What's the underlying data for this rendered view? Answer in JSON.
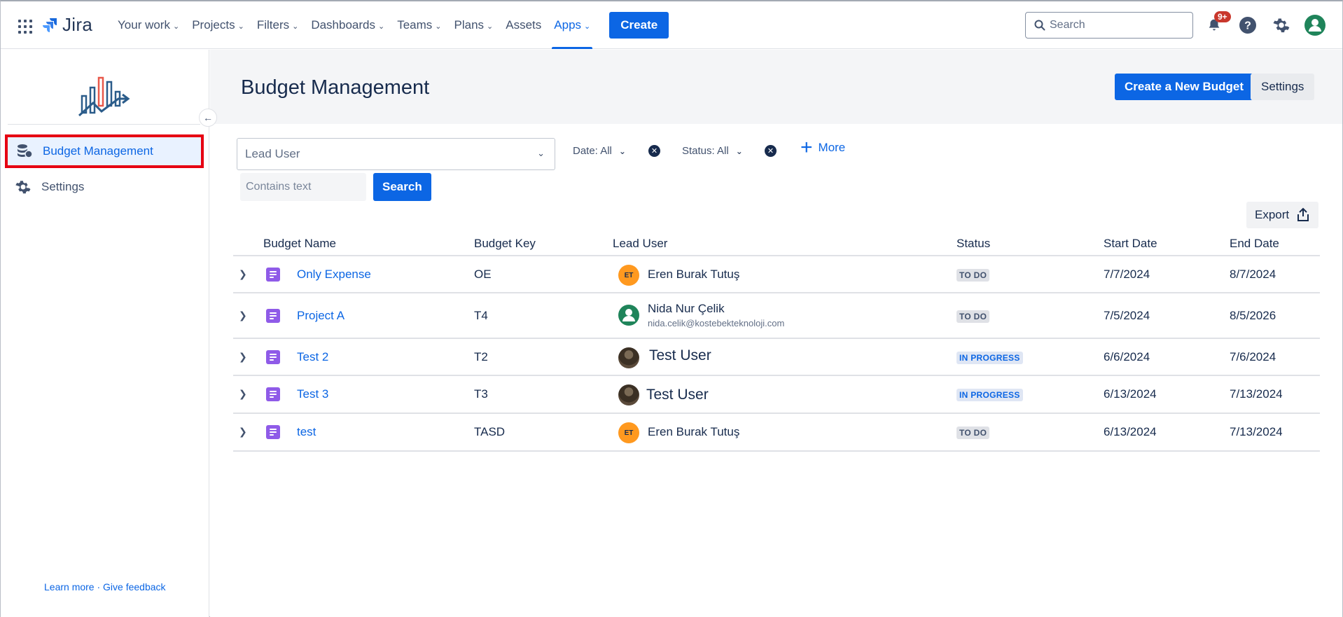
{
  "topnav": {
    "logo_text": "Jira",
    "items": [
      {
        "label": "Your work",
        "dropdown": true
      },
      {
        "label": "Projects",
        "dropdown": true
      },
      {
        "label": "Filters",
        "dropdown": true
      },
      {
        "label": "Dashboards",
        "dropdown": true
      },
      {
        "label": "Teams",
        "dropdown": true
      },
      {
        "label": "Plans",
        "dropdown": true
      },
      {
        "label": "Assets",
        "dropdown": false
      },
      {
        "label": "Apps",
        "dropdown": true,
        "active": true
      }
    ],
    "create_label": "Create",
    "search_placeholder": "Search",
    "notifications_badge": "9+",
    "icons": [
      "notification-bell-icon",
      "help-icon",
      "settings-gear-icon",
      "user-avatar-icon"
    ]
  },
  "sidebar": {
    "items": [
      {
        "label": "Budget Management",
        "icon": "coins-stack-icon",
        "active": true
      },
      {
        "label": "Settings",
        "icon": "gear-icon",
        "active": false
      }
    ],
    "footer_learn": "Learn more",
    "footer_sep": " · ",
    "footer_feedback": "Give feedback"
  },
  "header": {
    "title": "Budget Management",
    "create_button": "Create a New Budget",
    "settings_button": "Settings"
  },
  "filters": {
    "lead_user_placeholder": "Lead User",
    "date_filter": "Date: All",
    "status_filter": "Status: All",
    "more_label": "More",
    "contains_placeholder": "Contains text",
    "search_button": "Search",
    "export_button": "Export"
  },
  "table": {
    "columns": [
      "Budget Name",
      "Budget Key",
      "Lead User",
      "Status",
      "Start Date",
      "End Date"
    ],
    "rows": [
      {
        "name": "Only Expense",
        "key": "OE",
        "lead": "Eren Burak Tutuş",
        "lead_initials": "ET",
        "email": "",
        "status": "TO DO",
        "start": "7/7/2024",
        "end": "8/7/2024"
      },
      {
        "name": "Project A",
        "key": "T4",
        "lead": "Nida Nur Çelik",
        "lead_initials": "",
        "email": "nida.celik@kostebekteknoloji.com",
        "status": "TO DO",
        "start": "7/5/2024",
        "end": "8/5/2026"
      },
      {
        "name": "Test 2",
        "key": "T2",
        "lead": "Test User",
        "lead_initials": "",
        "email": "",
        "status": "IN PROGRESS",
        "start": "6/6/2024",
        "end": "7/6/2024"
      },
      {
        "name": "Test 3",
        "key": "T3",
        "lead": "Test User",
        "lead_initials": "",
        "email": "",
        "status": "IN PROGRESS",
        "start": "6/13/2024",
        "end": "7/13/2024"
      },
      {
        "name": "test",
        "key": "TASD",
        "lead": "Eren Burak Tutuş",
        "lead_initials": "ET",
        "email": "",
        "status": "TO DO",
        "start": "6/13/2024",
        "end": "7/13/2024"
      }
    ]
  },
  "colors": {
    "brand_blue": "#0c66e4",
    "todo_bg": "#dfe1e6",
    "in_progress_bg": "#dfe6f4",
    "highlight_border": "#e60012"
  }
}
